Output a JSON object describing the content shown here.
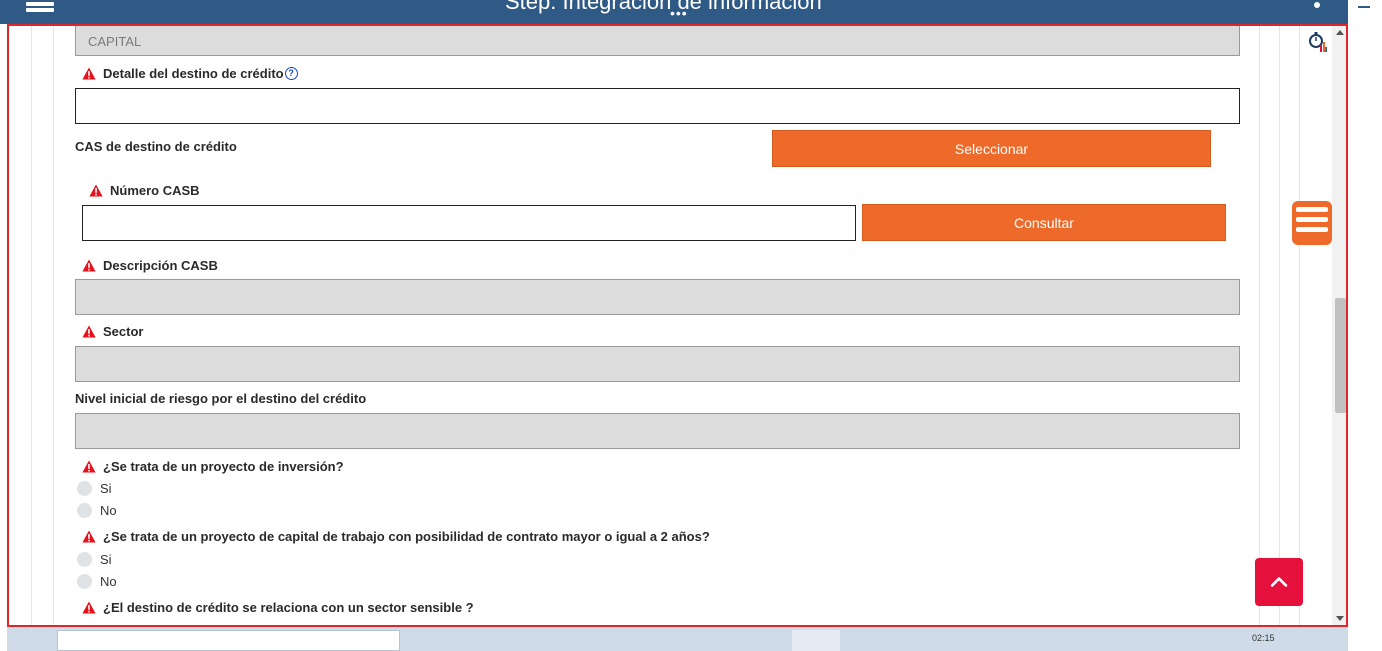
{
  "header": {
    "title": "Step: Integración de información",
    "more_dots": "•••"
  },
  "form": {
    "capital_value": "CAPITAL",
    "detalle_label": "Detalle del destino de crédito",
    "detalle_help": "?",
    "cas_label": "CAS de destino de crédito",
    "seleccionar_button": "Seleccionar",
    "numero_casb_label": "Número CASB",
    "consultar_button": "Consultar",
    "descripcion_casb_label": "Descripción CASB",
    "sector_label": "Sector",
    "nivel_label": "Nivel inicial de riesgo por el destino del crédito",
    "q1_label": "¿Se trata de un proyecto de inversión?",
    "q1_opt_si": "Si",
    "q1_opt_no": "No",
    "q2_label": "¿Se trata de un proyecto de capital de trabajo con posibilidad de contrato mayor o igual a 2 años?",
    "q2_opt_si": "Si",
    "q2_opt_no": "No",
    "q3_label": "¿El destino de crédito se relaciona con un sector sensible ?"
  },
  "taskbar": {
    "time": "02:15"
  },
  "colors": {
    "header_bg": "#2f5a85",
    "frame_border": "#e0262b",
    "accent_orange": "#ee6a2a",
    "scroll_top_red": "#e5103b",
    "warning_red": "#e8101a",
    "disabled_bg": "#dcdcdc"
  },
  "icons": {
    "hamburger": "hamburger-menu-icon",
    "kebab": "kebab-menu-icon",
    "warning": "warning-triangle-icon",
    "help": "help-circle-icon",
    "floating_menu": "floating-menu-icon",
    "scroll_top": "chevron-up-icon",
    "chart": "timer-chart-icon"
  }
}
